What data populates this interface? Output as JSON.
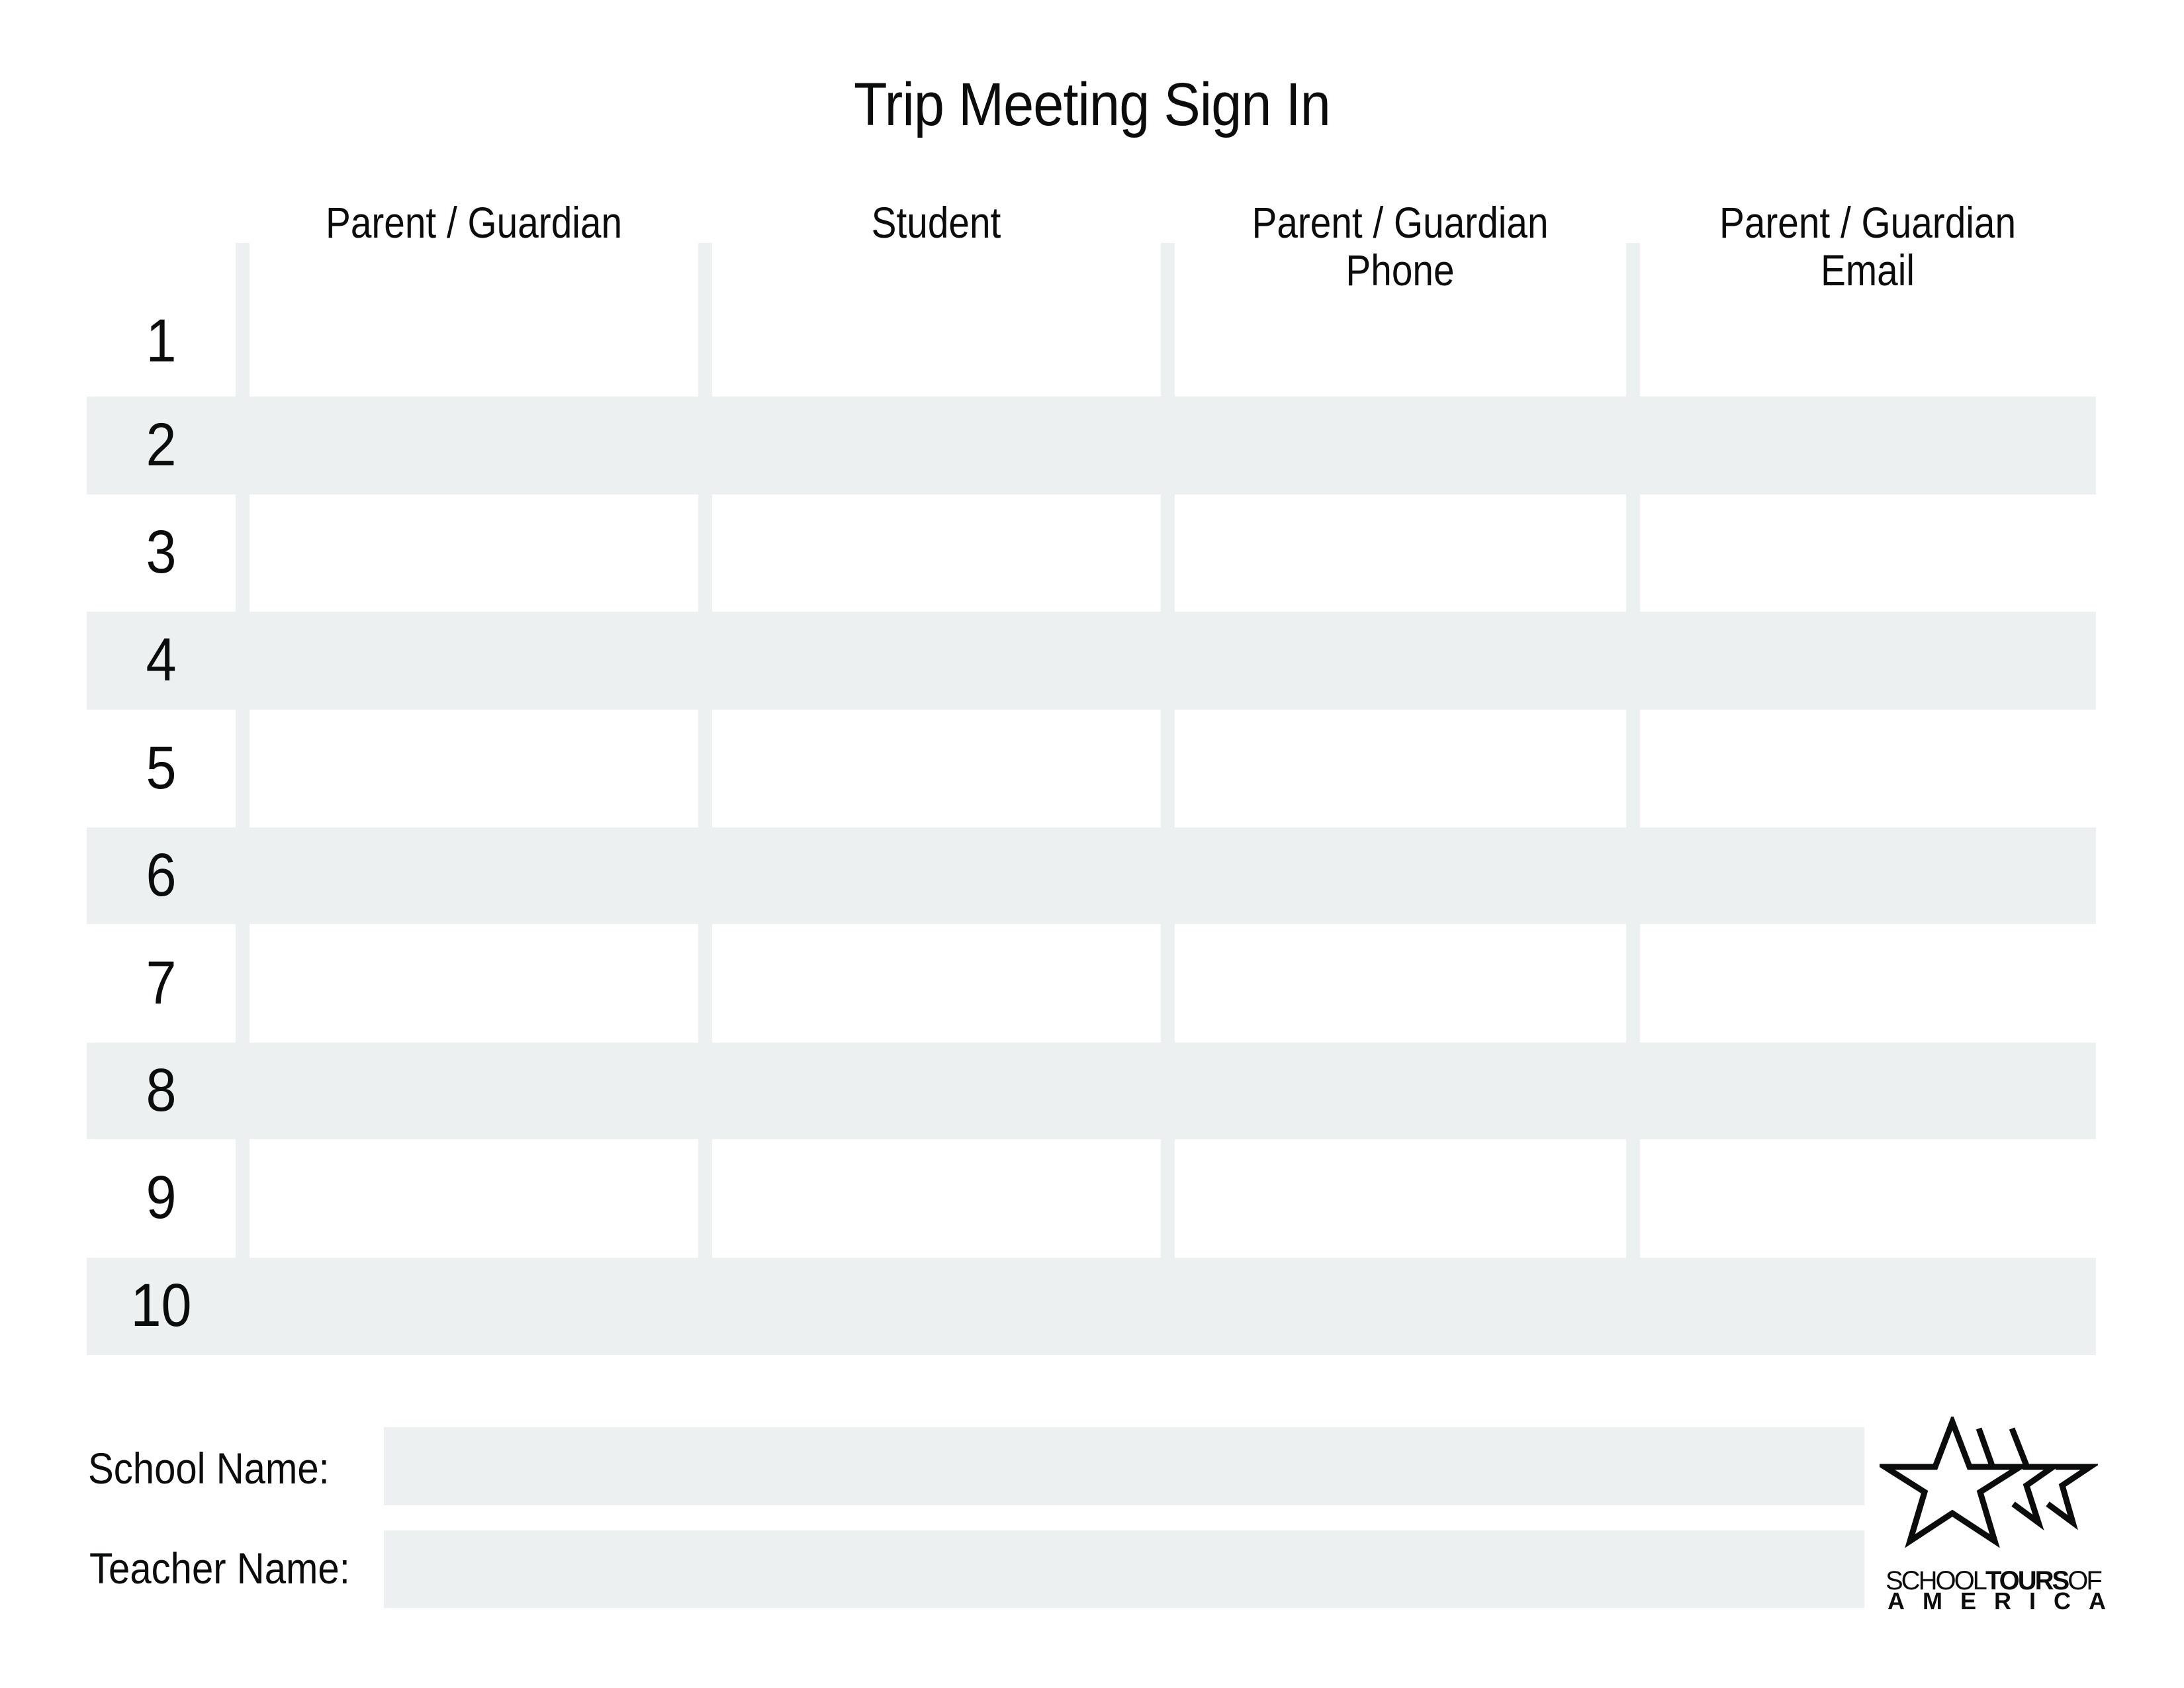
{
  "document": {
    "title": "Trip Meeting Sign In"
  },
  "table": {
    "headers": [
      {
        "line1": "Parent / Guardian",
        "line2": ""
      },
      {
        "line1": "Student",
        "line2": ""
      },
      {
        "line1": "Parent / Guardian",
        "line2": "Phone"
      },
      {
        "line1": "Parent / Guardian",
        "line2": "Email"
      }
    ],
    "rows": [
      {
        "number": "1",
        "parent_guardian": "",
        "student": "",
        "phone": "",
        "email": ""
      },
      {
        "number": "2",
        "parent_guardian": "",
        "student": "",
        "phone": "",
        "email": ""
      },
      {
        "number": "3",
        "parent_guardian": "",
        "student": "",
        "phone": "",
        "email": ""
      },
      {
        "number": "4",
        "parent_guardian": "",
        "student": "",
        "phone": "",
        "email": ""
      },
      {
        "number": "5",
        "parent_guardian": "",
        "student": "",
        "phone": "",
        "email": ""
      },
      {
        "number": "6",
        "parent_guardian": "",
        "student": "",
        "phone": "",
        "email": ""
      },
      {
        "number": "7",
        "parent_guardian": "",
        "student": "",
        "phone": "",
        "email": ""
      },
      {
        "number": "8",
        "parent_guardian": "",
        "student": "",
        "phone": "",
        "email": ""
      },
      {
        "number": "9",
        "parent_guardian": "",
        "student": "",
        "phone": "",
        "email": ""
      },
      {
        "number": "10",
        "parent_guardian": "",
        "student": "",
        "phone": "",
        "email": ""
      }
    ]
  },
  "footer": {
    "school_name_label": "School Name:",
    "school_name_value": "",
    "teacher_name_label": "Teacher Name:",
    "teacher_name_value": ""
  },
  "logo": {
    "icon": "three-stars-icon",
    "line1_regular_a": "SCHOOL",
    "line1_bold": "TOURS",
    "line1_regular_b": "OF",
    "line2": "AMERICA"
  },
  "colors": {
    "row_stripe": "#ECF0F1",
    "text": "#0B0C0C",
    "background": "#FFFFFF"
  }
}
